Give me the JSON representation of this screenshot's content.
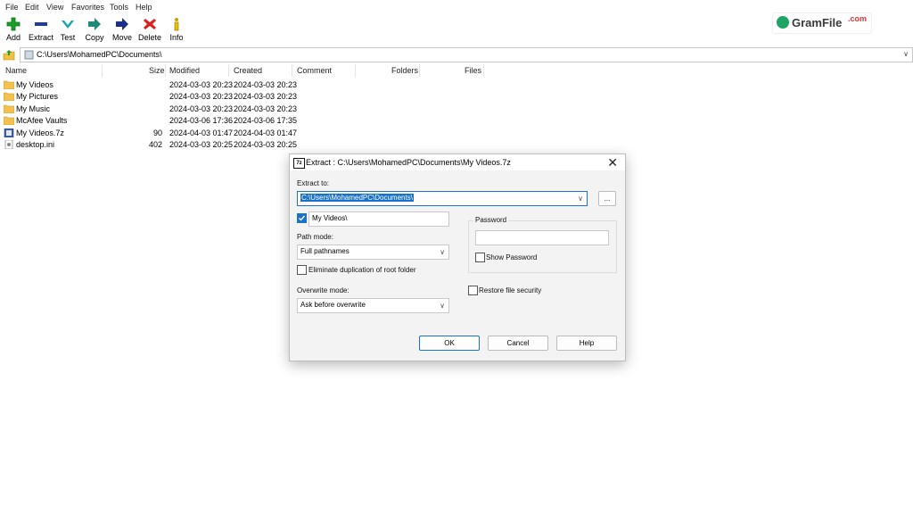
{
  "menu": [
    "File",
    "Edit",
    "View",
    "Favorites",
    "Tools",
    "Help"
  ],
  "toolbar": [
    {
      "label": "Add",
      "icon": "add-icon"
    },
    {
      "label": "Extract",
      "icon": "extract-icon"
    },
    {
      "label": "Test",
      "icon": "test-icon"
    },
    {
      "label": "Copy",
      "icon": "copy-icon"
    },
    {
      "label": "Move",
      "icon": "move-icon"
    },
    {
      "label": "Delete",
      "icon": "delete-icon"
    },
    {
      "label": "Info",
      "icon": "info-icon"
    }
  ],
  "watermark": {
    "name": "GramFile",
    "suffix": ".com"
  },
  "address": {
    "path": "C:\\Users\\MohamedPC\\Documents\\"
  },
  "columns": [
    "Name",
    "Size",
    "Modified",
    "Created",
    "Comment",
    "Folders",
    "Files"
  ],
  "files": [
    {
      "name": "My Videos",
      "size": "",
      "modified": "2024-03-03 20:23",
      "created": "2024-03-03 20:23",
      "type": "folder"
    },
    {
      "name": "My Pictures",
      "size": "",
      "modified": "2024-03-03 20:23",
      "created": "2024-03-03 20:23",
      "type": "folder"
    },
    {
      "name": "My Music",
      "size": "",
      "modified": "2024-03-03 20:23",
      "created": "2024-03-03 20:23",
      "type": "folder"
    },
    {
      "name": "McAfee Vaults",
      "size": "",
      "modified": "2024-03-06 17:36",
      "created": "2024-03-06 17:35",
      "type": "folder"
    },
    {
      "name": "My Videos.7z",
      "size": "90",
      "modified": "2024-04-03 01:47",
      "created": "2024-04-03 01:47",
      "type": "archive"
    },
    {
      "name": "desktop.ini",
      "size": "402",
      "modified": "2024-03-03 20:25",
      "created": "2024-03-03 20:25",
      "type": "ini"
    }
  ],
  "dialog": {
    "title": "Extract : C:\\Users\\MohamedPC\\Documents\\My Videos.7z",
    "title_icon": "7z",
    "close": "✕",
    "extract_to_label": "Extract to:",
    "extract_to_value": "C:\\Users\\MohamedPC\\Documents\\",
    "browse_label": "...",
    "subfolder_value": "My Videos\\",
    "subfolder_checked": true,
    "path_mode_label": "Path mode:",
    "path_mode_value": "Full pathnames",
    "eliminate_label": "Eliminate duplication of root folder",
    "overwrite_label": "Overwrite mode:",
    "overwrite_value": "Ask before overwrite",
    "password_label": "Password",
    "show_password_label": "Show Password",
    "restore_label": "Restore file security",
    "ok": "OK",
    "cancel": "Cancel",
    "help": "Help"
  }
}
